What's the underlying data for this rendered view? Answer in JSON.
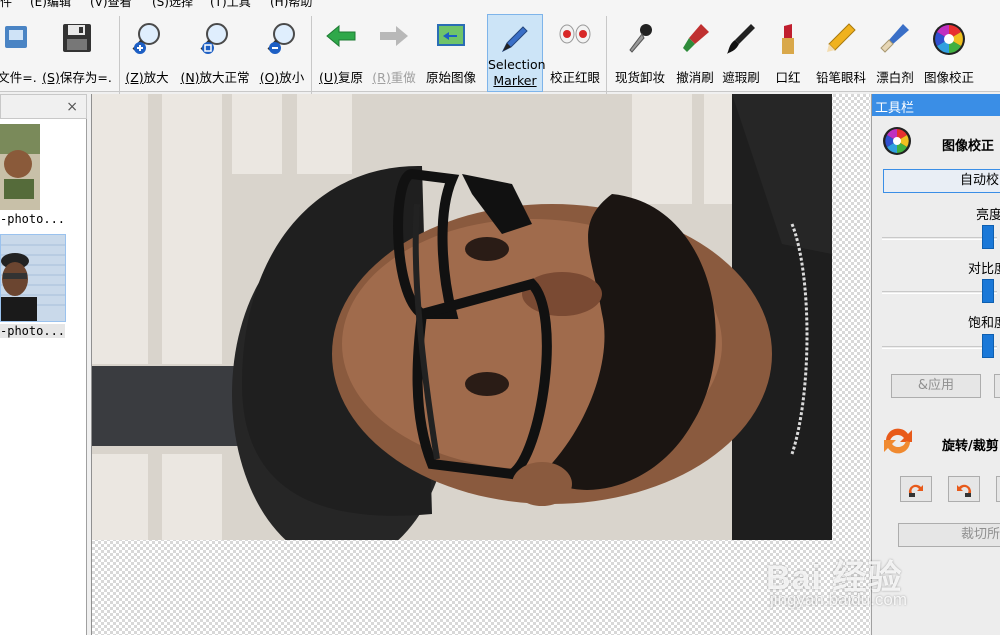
{
  "menu": [
    "件",
    "(E)编辑",
    "(V)查看",
    "(S)选择",
    "(T)工具",
    "(H)帮助"
  ],
  "toolbar": {
    "open_file": {
      "hotkey": "",
      "label": "文件=."
    },
    "save_as": {
      "hotkey": "(S)",
      "label": "保存为=."
    },
    "zoom_in": {
      "hotkey": "(Z)",
      "label": "放大"
    },
    "zoom_normal": {
      "hotkey": "(N)",
      "label": "放大正常"
    },
    "zoom_out": {
      "hotkey": "(O)",
      "label": "放小"
    },
    "undo": {
      "hotkey": "(U)",
      "label": "复原"
    },
    "redo": {
      "hotkey": "(R)",
      "label": "重做"
    },
    "original": {
      "label": "原始图像"
    },
    "selection_marker": {
      "line1": "Selection",
      "line2": "Marker"
    },
    "redeye": {
      "label": "校正红眼"
    },
    "remove_makeup": {
      "label": "现货卸妆"
    },
    "undo_brush": {
      "label": "撤消刷"
    },
    "blemish": {
      "label": "遮瑕刷"
    },
    "lipstick": {
      "label": "口红"
    },
    "eyeliner": {
      "label": "铅笔眼科"
    },
    "whitening": {
      "label": "漂白剂"
    },
    "color_correct": {
      "label": "图像校正"
    }
  },
  "thumbnails": [
    {
      "caption": "-photo..."
    },
    {
      "caption": "-photo..."
    }
  ],
  "close_glyph": "×",
  "panel": {
    "title": "工具栏",
    "image_correction": {
      "title": "图像校正",
      "auto_button": "自动校",
      "brightness": "亮度",
      "contrast": "对比度",
      "saturation": "饱和度",
      "apply": "&应用"
    },
    "rotate_crop": {
      "title": "旋转/裁剪",
      "crop_button": "裁切所"
    }
  },
  "watermark": {
    "text": "Bai 经验",
    "sub": "jingyan.baidu.com"
  },
  "colors": {
    "accent": "#3a8ee6",
    "selected_bg": "#cce4f7",
    "slider": "#1a78d8"
  }
}
